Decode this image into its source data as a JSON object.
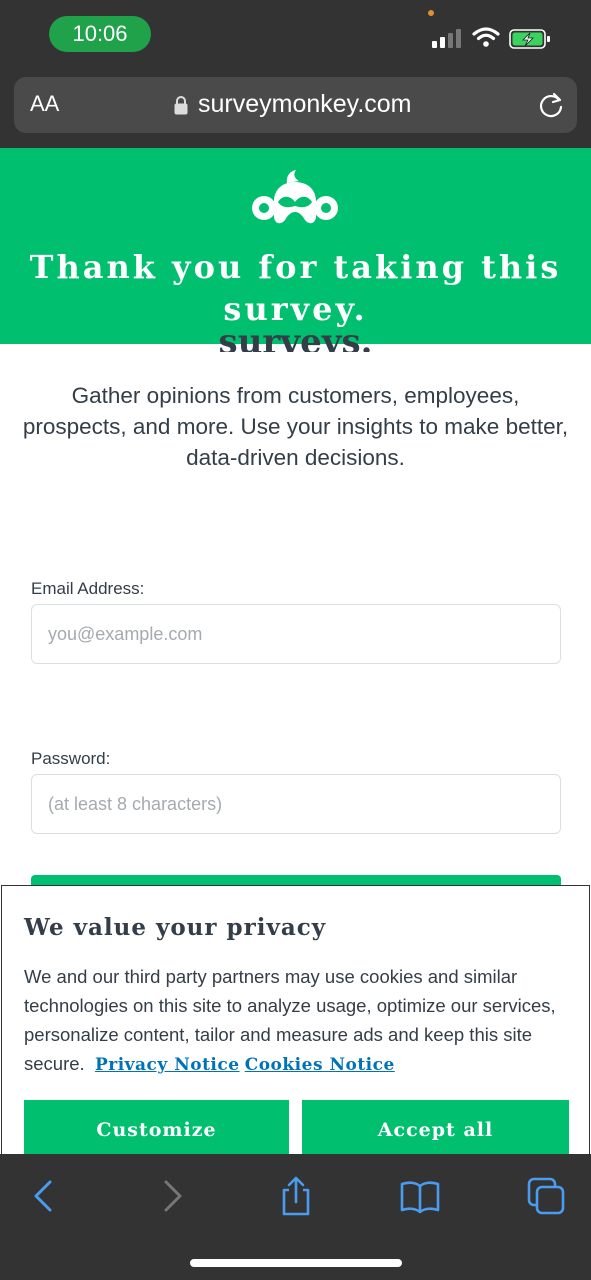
{
  "status_bar": {
    "time": "10:06"
  },
  "browser": {
    "text_size_button": "AA",
    "url": "surveymonkey.com",
    "icons": {
      "lock": "lock-icon",
      "reload": "reload-icon"
    }
  },
  "banner": {
    "logo": "surveymonkey-logo",
    "title": "Thank you for taking this survey.",
    "background_color": "#00bf6f"
  },
  "page": {
    "cut_heading": "surveys.",
    "intro": "Gather opinions from customers, employees, prospects, and more. Use your insights to make better, data-driven decisions.",
    "email_label": "Email Address:",
    "email_placeholder": "you@example.com",
    "password_label": "Password:",
    "password_placeholder": "(at least 8 characters)"
  },
  "privacy": {
    "title": "We value your privacy",
    "body": "We and our third party partners may use cookies and similar technologies on this site to analyze usage, optimize our services, personalize content, tailor and measure ads and keep this site secure.",
    "privacy_link": "Privacy Notice",
    "cookies_link": "Cookies Notice",
    "customize_label": "Customize",
    "accept_label": "Accept all"
  },
  "toolbar": {
    "icons": [
      "back-icon",
      "forward-icon",
      "share-icon",
      "bookmarks-icon",
      "tabs-icon"
    ],
    "accent_color": "#4a9cf0"
  }
}
